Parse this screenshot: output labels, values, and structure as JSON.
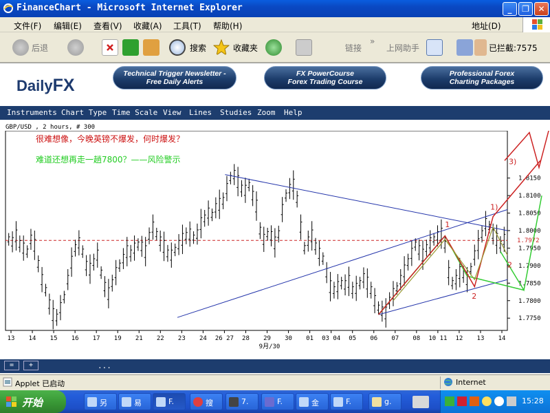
{
  "window": {
    "title": "FinanceChart - Microsoft Internet Explorer",
    "minimize": "_",
    "maximize": "❐",
    "close": "✕"
  },
  "menu": {
    "items": [
      "文件(F)",
      "编辑(E)",
      "查看(V)",
      "收藏(A)",
      "工具(T)",
      "帮助(H)"
    ],
    "address_label": "地址(D)"
  },
  "toolbar": {
    "back": "后退",
    "search": "搜索",
    "favorites": "收藏夹",
    "links": "链接",
    "links_more": "»",
    "internet_assistant": "上网助手",
    "blocked": "已拦截:7575"
  },
  "banner": {
    "logo_daily": "Daily",
    "logo_fx": "FX",
    "pills": [
      {
        "line1": "Technical Trigger Newsletter -",
        "line2": "Free Daily Alerts"
      },
      {
        "line1": "FX PowerCourse",
        "line2": "Forex Trading Course"
      },
      {
        "line1": "Professional Forex",
        "line2": "Charting Packages"
      }
    ]
  },
  "chart_menu": [
    "Instruments",
    "Chart Type",
    "Time Scale",
    "View",
    "Lines",
    "Studies",
    "Zoom",
    "Help"
  ],
  "chart_footer": {
    "btn1": "=",
    "btn2": "+",
    "dots": "..."
  },
  "chart_data": {
    "type": "line",
    "symbol_label": "GBP/USD , 2 hours, # 300",
    "annotation_red": "很难想像，今晚英镑不爆发，何时爆发？",
    "annotation_green": "难道还想再走一趟7800？——风险警示",
    "ylim": [
      1.7715,
      1.8285
    ],
    "y_ticks": [
      "1.8150",
      "1.8100",
      "1.8050",
      "1.8000",
      "1.7950",
      "1.7900",
      "1.7850",
      "1.7800",
      "1.7750"
    ],
    "current_price": "1.7972",
    "current_price_color": "#cc2222",
    "x_ticks": [
      "13",
      "14",
      "15",
      "16",
      "17",
      "19",
      "21",
      "22",
      "23",
      "24",
      "26 27",
      "28",
      "29",
      "30",
      "01",
      "03 04",
      "05",
      "06",
      "07",
      "08",
      "10 11",
      "12",
      "13",
      "14"
    ],
    "x_sublabel": "9月/30",
    "wave_labels": [
      "1",
      "2",
      "1)",
      "2",
      "3",
      "3)"
    ],
    "series": [
      {
        "values": [
          1.7975,
          1.7968,
          1.7985,
          1.7962,
          1.795,
          1.794,
          1.7975,
          1.7958,
          1.7905,
          1.786,
          1.783,
          1.779,
          1.776,
          1.7752,
          1.778,
          1.781,
          1.786,
          1.791,
          1.795,
          1.7965,
          1.794,
          1.79,
          1.789,
          1.791,
          1.793,
          1.788,
          1.784,
          1.782,
          1.785,
          1.788,
          1.79,
          1.792,
          1.794,
          1.7935,
          1.795,
          1.796,
          1.7955,
          1.794,
          1.7985,
          1.801,
          1.799,
          1.797,
          1.7955,
          1.7935,
          1.793,
          1.7945,
          1.796,
          1.7975,
          1.7985,
          1.799,
          1.798,
          1.799,
          1.802,
          1.8035,
          1.805,
          1.8045,
          1.8065,
          1.8075,
          1.8085,
          1.812,
          1.815,
          1.816,
          1.814,
          1.812,
          1.8115,
          1.813,
          1.81,
          1.807,
          1.8,
          1.7975,
          1.799,
          1.7985,
          1.7965,
          1.799,
          1.806,
          1.81,
          1.812,
          1.813,
          1.809,
          1.801,
          1.795,
          1.797,
          1.7985,
          1.7955,
          1.7935,
          1.792,
          1.788,
          1.784,
          1.783,
          1.784,
          1.785,
          1.7845,
          1.7855,
          1.783,
          1.7835,
          1.785,
          1.7865,
          1.785,
          1.783,
          1.78,
          1.778,
          1.777,
          1.7765,
          1.78,
          1.782,
          1.7835,
          1.786,
          1.7885,
          1.791,
          1.7935,
          1.796,
          1.7945,
          1.793,
          1.795,
          1.7965,
          1.7975,
          1.7985,
          1.799,
          1.796,
          1.788,
          1.785,
          1.786,
          1.788,
          1.7875,
          1.786,
          1.789,
          1.793,
          1.796,
          1.799,
          1.802,
          1.801,
          1.799,
          1.7975,
          1.796,
          1.7975
        ],
        "color": "#000000"
      }
    ],
    "lines": {
      "blue_color": "#2233aa",
      "dashed_color": "#cc2222",
      "green_color": "#33cc33",
      "red_color": "#cc2222",
      "olive_color": "#999933"
    }
  },
  "status": {
    "applet": "Applet 已启动",
    "zone": "Internet"
  },
  "taskbar": {
    "start": "开始",
    "buttons": [
      "另",
      "易",
      "F.",
      "搜",
      "7.",
      "F.",
      "金",
      "F.",
      "g."
    ],
    "clock": "15:28"
  }
}
